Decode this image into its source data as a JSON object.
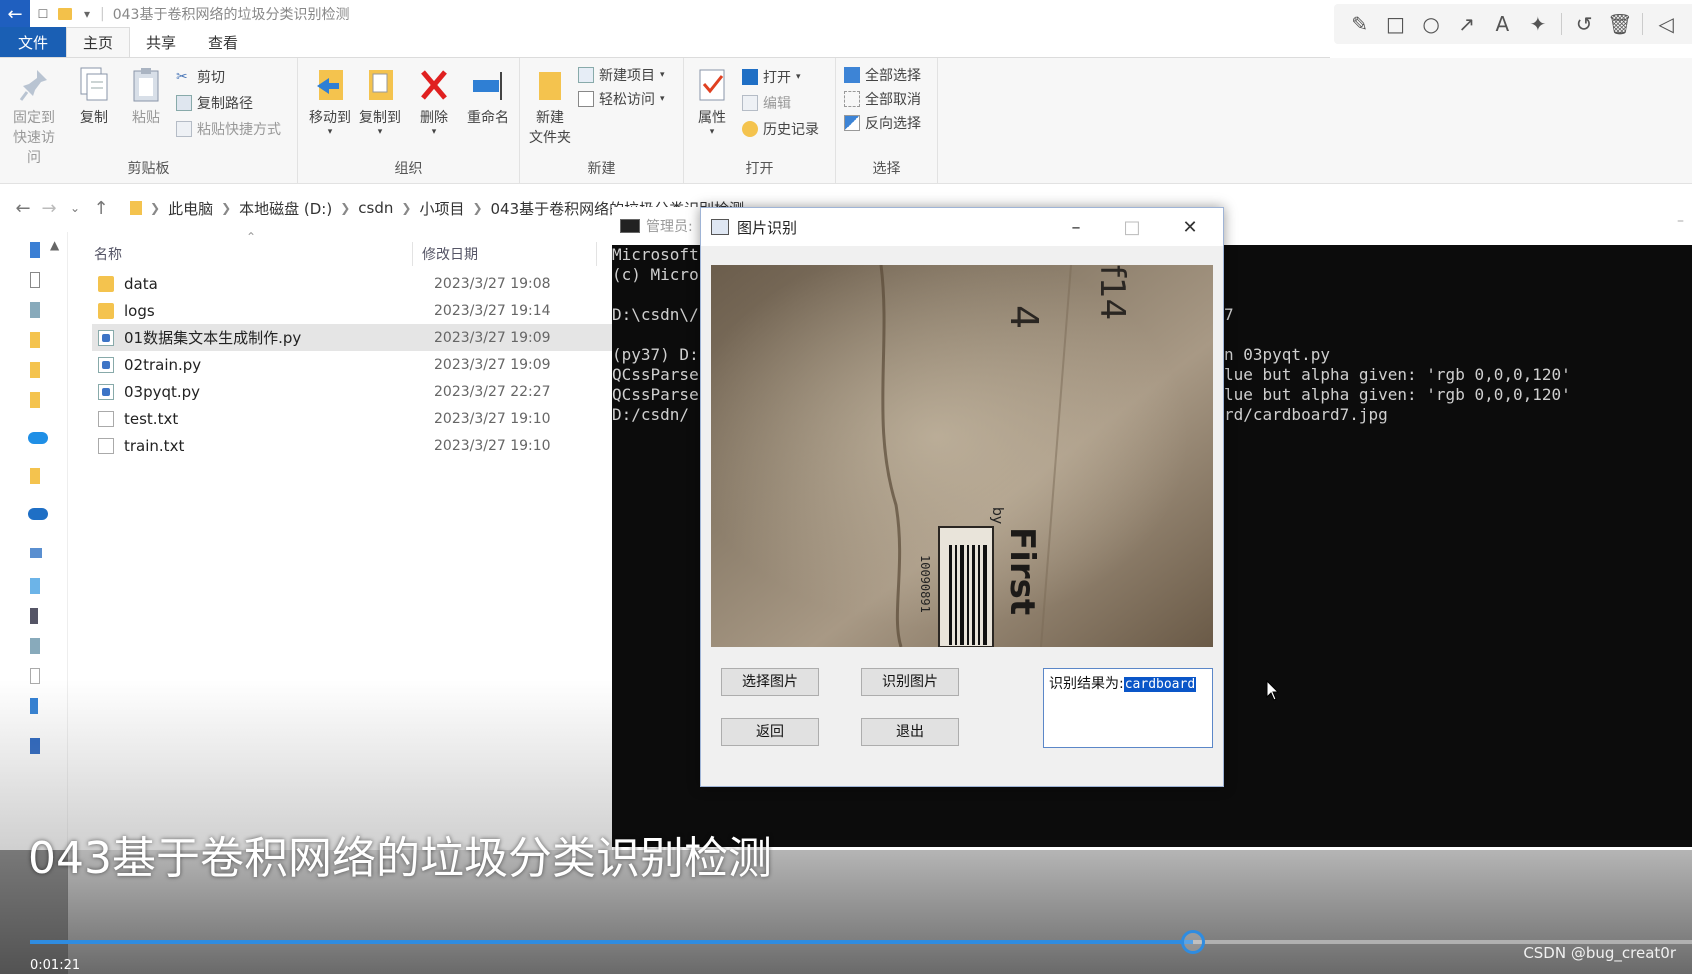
{
  "window": {
    "title": "043基于卷积网络的垃圾分类识别检测"
  },
  "ribbon_tabs": [
    "文件",
    "主页",
    "共享",
    "查看"
  ],
  "ribbon": {
    "clipboard": {
      "label": "剪贴板",
      "pin": [
        "固定到",
        "快速访问"
      ],
      "copy": "复制",
      "paste": "粘贴",
      "cut": "剪切",
      "copy_path": "复制路径",
      "paste_shortcut": "粘贴快捷方式"
    },
    "organize": {
      "label": "组织",
      "move_to": "移动到",
      "copy_to": "复制到",
      "delete": "删除",
      "rename": "重命名"
    },
    "new": {
      "label": "新建",
      "new_folder": [
        "新建",
        "文件夹"
      ],
      "new_item": "新建项目",
      "easy_access": "轻松访问"
    },
    "open": {
      "label": "打开",
      "properties": "属性",
      "open": "打开",
      "edit": "编辑",
      "history": "历史记录"
    },
    "select": {
      "label": "选择",
      "select_all": "全部选择",
      "select_none": "全部取消",
      "invert": "反向选择"
    }
  },
  "breadcrumb": [
    "此电脑",
    "本地磁盘 (D:)",
    "csdn",
    "小项目",
    "043基于卷积网络的垃圾分类识别检测"
  ],
  "columns": {
    "name": "名称",
    "date": "修改日期"
  },
  "files": [
    {
      "name": "data",
      "date": "2023/3/27 19:08",
      "type": "folder"
    },
    {
      "name": "logs",
      "date": "2023/3/27 19:14",
      "type": "folder"
    },
    {
      "name": "01数据集文本生成制作.py",
      "date": "2023/3/27 19:09",
      "type": "py"
    },
    {
      "name": "02train.py",
      "date": "2023/3/27 19:09",
      "type": "py"
    },
    {
      "name": "03pyqt.py",
      "date": "2023/3/27 22:27",
      "type": "py"
    },
    {
      "name": "test.txt",
      "date": "2023/3/27 19:10",
      "type": "txt"
    },
    {
      "name": "train.txt",
      "date": "2023/3/27 19:10",
      "type": "txt"
    }
  ],
  "console": {
    "title": "管理员:",
    "lines_left": [
      "Microsoft",
      "(c) Micro",
      "",
      "D:\\csdn\\/",
      "",
      "(py37) D:",
      "QCssParse",
      "QCssParse",
      "D:/csdn/"
    ],
    "lines_right": [
      "7",
      "",
      "n 03pyqt.py",
      "lue but alpha given: 'rgb 0,0,0,120'",
      "lue but alpha given: 'rgb 0,0,0,120'",
      "rd/cardboard7.jpg"
    ]
  },
  "dialog": {
    "title": "图片识别",
    "btn_select": "选择图片",
    "btn_recognize": "识别图片",
    "btn_back": "返回",
    "btn_exit": "退出",
    "result_label": "识别结果为:",
    "result_value": "cardboard",
    "photo_text": {
      "f14": "f14",
      "four": "4",
      "by": "by",
      "brand": "First",
      "barcode_num": "10090891"
    }
  },
  "video": {
    "title": "043基于卷积网络的垃圾分类识别检测",
    "time": "0:01:21",
    "progress": 0.7,
    "watermark": "CSDN @bug_creat0r"
  }
}
